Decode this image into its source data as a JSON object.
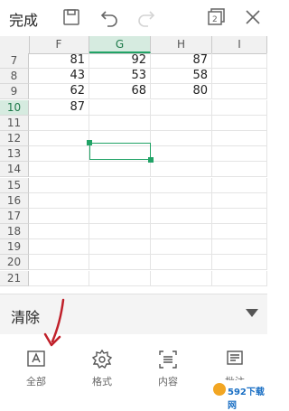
{
  "toolbar": {
    "done_label": "完成",
    "icons": [
      "save-icon",
      "undo-icon",
      "redo-icon",
      "sheets-icon",
      "close-icon"
    ]
  },
  "sheet": {
    "columns": [
      "F",
      "G",
      "H",
      "I"
    ],
    "active_column": "G",
    "rows": [
      {
        "num": "7",
        "F": "81",
        "G": "92",
        "H": "87"
      },
      {
        "num": "8",
        "F": "43",
        "G": "53",
        "H": "58"
      },
      {
        "num": "9",
        "F": "62",
        "G": "68",
        "H": "80"
      },
      {
        "num": "10",
        "F": "87",
        "G": "",
        "H": ""
      },
      {
        "num": "11"
      },
      {
        "num": "12"
      },
      {
        "num": "13"
      },
      {
        "num": "14"
      },
      {
        "num": "15"
      },
      {
        "num": "16"
      },
      {
        "num": "17"
      },
      {
        "num": "18"
      },
      {
        "num": "19"
      },
      {
        "num": "20"
      },
      {
        "num": "21"
      }
    ],
    "active_row": "10",
    "selected_cell": "G10"
  },
  "clear_panel": {
    "label": "清除"
  },
  "options": [
    {
      "label": "全部",
      "icon": "clear-all-icon"
    },
    {
      "label": "格式",
      "icon": "format-icon"
    },
    {
      "label": "内容",
      "icon": "content-icon"
    },
    {
      "label": "批注",
      "icon": "comment-icon"
    }
  ],
  "watermark": {
    "text": "592下载网"
  },
  "colors": {
    "accent": "#21a366",
    "annotation_arrow": "#c0202a",
    "header_bg": "#f1f1f1"
  }
}
